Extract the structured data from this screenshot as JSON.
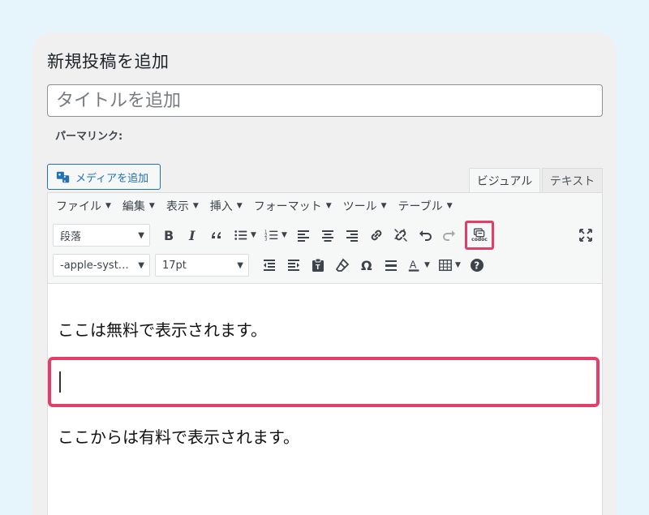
{
  "page": {
    "title": "新規投稿を追加",
    "title_placeholder": "タイトルを追加",
    "permalink_label": "パーマリンク:"
  },
  "media_button": {
    "label": "メディアを追加",
    "icon": "media-icon"
  },
  "tabs": {
    "visual": "ビジュアル",
    "text": "テキスト",
    "active": "visual"
  },
  "menubar": [
    {
      "label": "ファイル"
    },
    {
      "label": "編集"
    },
    {
      "label": "表示"
    },
    {
      "label": "挿入"
    },
    {
      "label": "フォーマット"
    },
    {
      "label": "ツール"
    },
    {
      "label": "テーブル"
    }
  ],
  "toolbar": {
    "format_select": "段落",
    "font_select": "-apple-syst…",
    "size_select": "17pt",
    "codoc_label": "codoc"
  },
  "content": {
    "paragraph_free": "ここは無料で表示されます。",
    "paragraph_paid": "ここからは有料で表示されます。"
  },
  "colors": {
    "highlight": "#e23e68",
    "link": "#2271b1",
    "background": "#e6f4fb"
  }
}
